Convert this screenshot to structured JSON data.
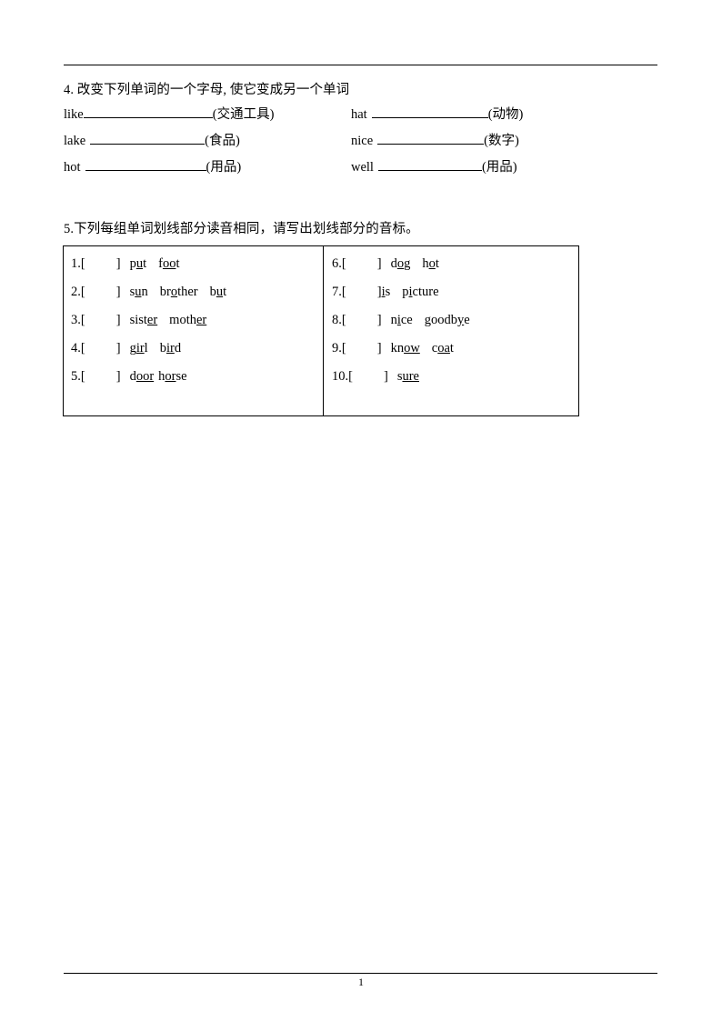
{
  "document": {
    "page_number": "1"
  },
  "section4": {
    "title": "4. 改变下列单词的一个字母, 使它变成另一个单词",
    "rows": [
      {
        "left": {
          "word": "like",
          "space_before_blank": false,
          "hint": "(交通工具)"
        },
        "right": {
          "word": "hat",
          "space_before_blank": true,
          "hint": "(动物)"
        }
      },
      {
        "left": {
          "word": "lake",
          "space_before_blank": true,
          "hint": "(食品)"
        },
        "right": {
          "word": "nice",
          "space_before_blank": true,
          "hint": "(数字)"
        }
      },
      {
        "left": {
          "word": "hot",
          "space_before_blank": true,
          "hint": "(用品)"
        },
        "right": {
          "word": "well",
          "space_before_blank": true,
          "hint": "(用品)"
        }
      }
    ]
  },
  "section5": {
    "title": "5.下列每组单词划线部分读音相同，请写出划线部分的音标。",
    "bracket_open": "[",
    "bracket_close": "]",
    "items_left": [
      {
        "number": "1.",
        "hug": false,
        "words": [
          {
            "pre": "p",
            "mid": "u",
            "post": "t"
          },
          {
            "pre": "f",
            "mid": "oo",
            "post": "t"
          }
        ]
      },
      {
        "number": "2.",
        "hug": false,
        "words": [
          {
            "pre": "s",
            "mid": "u",
            "post": "n"
          },
          {
            "pre": "br",
            "mid": "o",
            "post": "ther"
          },
          {
            "pre": "b",
            "mid": "u",
            "post": "t"
          }
        ]
      },
      {
        "number": "3.",
        "hug": false,
        "words": [
          {
            "pre": "sist",
            "mid": "er",
            "post": ""
          },
          {
            "pre": "moth",
            "mid": "er",
            "post": ""
          }
        ]
      },
      {
        "number": "4.",
        "hug": false,
        "words": [
          {
            "pre": "g",
            "mid": "ir",
            "post": "l"
          },
          {
            "pre": "b",
            "mid": "ir",
            "post": "d"
          }
        ]
      },
      {
        "number": "5.",
        "hug": false,
        "tight": true,
        "words": [
          {
            "pre": "d",
            "mid": "oor",
            "post": ""
          },
          {
            "pre": "h",
            "mid": "or",
            "post": "se"
          }
        ]
      }
    ],
    "items_right": [
      {
        "number": "6.",
        "hug": false,
        "words": [
          {
            "pre": "d",
            "mid": "o",
            "post": "g"
          },
          {
            "pre": "h",
            "mid": "o",
            "post": "t"
          }
        ]
      },
      {
        "number": "7.",
        "hug": true,
        "words": [
          {
            "pre": "",
            "mid": "i",
            "post": "s"
          },
          {
            "pre": "p",
            "mid": "i",
            "post": "cture"
          }
        ]
      },
      {
        "number": "8.",
        "hug": false,
        "words": [
          {
            "pre": "n",
            "mid": "i",
            "post": "ce"
          },
          {
            "pre": "goodb",
            "mid": "y",
            "post": "e"
          }
        ]
      },
      {
        "number": "9.",
        "hug": false,
        "words": [
          {
            "pre": "kn",
            "mid": "ow",
            "post": ""
          },
          {
            "pre": "c",
            "mid": "oa",
            "post": "t"
          }
        ]
      },
      {
        "number": "10.",
        "hug": false,
        "words": [
          {
            "pre": "s",
            "mid": "ure",
            "post": ""
          }
        ]
      }
    ]
  }
}
